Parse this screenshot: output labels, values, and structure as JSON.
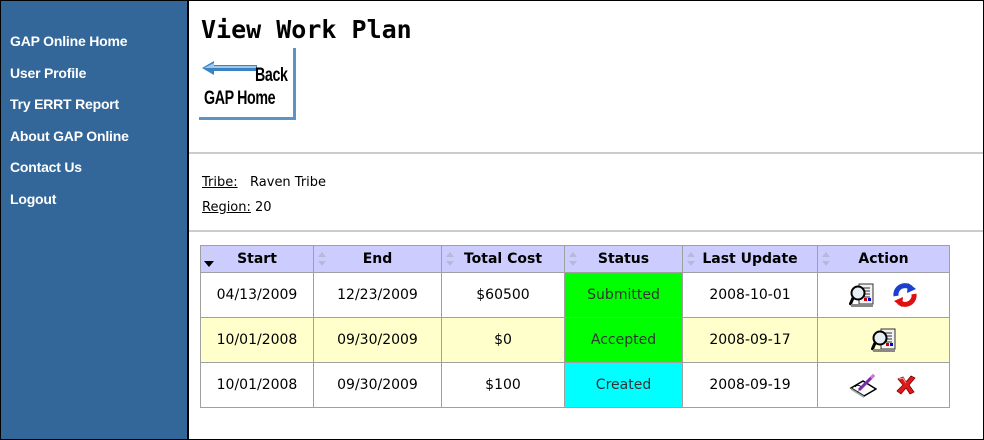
{
  "sidebar": {
    "items": [
      {
        "label": "GAP Online Home"
      },
      {
        "label": "User Profile"
      },
      {
        "label": "Try ERRT Report"
      },
      {
        "label": "About GAP Online"
      },
      {
        "label": "Contact Us"
      },
      {
        "label": "Logout"
      }
    ]
  },
  "page": {
    "title": "View Work Plan"
  },
  "back_button": {
    "back_label": "Back",
    "home_label": "GAP Home"
  },
  "info": {
    "tribe_label": "Tribe:",
    "tribe_value": "Raven Tribe",
    "region_label": "Region:",
    "region_value": "20"
  },
  "table": {
    "headers": [
      "Start",
      "End",
      "Total Cost",
      "Status",
      "Last Update",
      "Action"
    ],
    "sorted_column": "Start",
    "rows": [
      {
        "start": "04/13/2009",
        "end": "12/23/2009",
        "cost": "$60500",
        "status": "Submitted",
        "updated": "2008-10-01",
        "actions": [
          "view-plan-icon",
          "refresh-icon"
        ]
      },
      {
        "start": "10/01/2008",
        "end": "09/30/2009",
        "cost": "$0",
        "status": "Accepted",
        "updated": "2008-09-17",
        "actions": [
          "view-plan-icon"
        ]
      },
      {
        "start": "10/01/2008",
        "end": "09/30/2009",
        "cost": "$100",
        "status": "Created",
        "updated": "2008-09-19",
        "actions": [
          "edit-plan-icon",
          "delete-icon"
        ]
      }
    ]
  },
  "colors": {
    "sidebar": "#336699",
    "header_bg": "#ccccff",
    "row_alt": "#ffffcc",
    "status_green": "#00ff00",
    "status_cyan": "#00ffff"
  }
}
